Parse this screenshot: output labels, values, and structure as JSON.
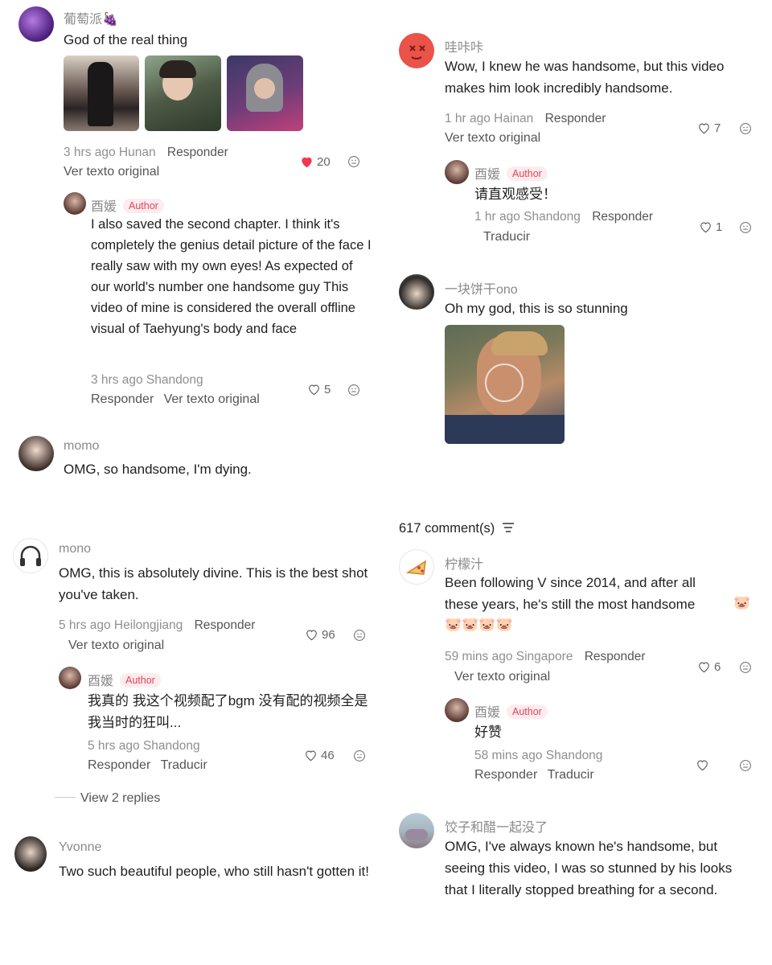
{
  "left": {
    "c1": {
      "user": "葡萄派🍇",
      "text": "God of the real thing",
      "time": "3 hrs ago Hunan",
      "reply": "Responder",
      "translate": "Ver texto original",
      "likes": "20",
      "reply1": {
        "user": "酉媛",
        "badge": "Author",
        "text": "I also saved the second chapter. I think it's completely the genius detail picture of the face I really saw with my own eyes! As expected of our world's number one handsome guy This video of mine is considered the overall offline visual of Taehyung's body and face",
        "time": "3 hrs ago Shandong",
        "reply": "Responder",
        "translate": "Ver texto original",
        "likes": "5"
      }
    },
    "c2": {
      "user": "momo",
      "text": "OMG, so handsome, I'm dying."
    },
    "c3": {
      "user": "mono",
      "text": "OMG, this is absolutely divine. This is the best shot you've taken.",
      "time": "5 hrs ago Heilongjiang",
      "reply": "Responder",
      "translate": "Ver texto original",
      "likes": "96",
      "reply1": {
        "user": "酉媛",
        "badge": "Author",
        "text": "我真的 我这个视频配了bgm 没有配的视频全是我当时的狂叫...",
        "time": "5 hrs ago Shandong",
        "reply": "Responder",
        "translate": "Traducir",
        "likes": "46"
      },
      "view_replies": "View 2 replies"
    },
    "c4": {
      "user": "Yvonne",
      "text": "Two such beautiful people, who still hasn't gotten it!"
    }
  },
  "right": {
    "c1": {
      "user": "哇咔咔",
      "text": "Wow, I knew he was handsome, but this video makes him look incredibly handsome.",
      "time": "1 hr ago Hainan",
      "reply": "Responder",
      "translate": "Ver texto original",
      "likes": "7",
      "reply1": {
        "user": "酉媛",
        "badge": "Author",
        "text": "请直观感受！",
        "time": "1 hr ago Shandong",
        "reply": "Responder",
        "translate": "Traducir",
        "likes": "1"
      }
    },
    "c2": {
      "user": "一块饼干ono",
      "text": "Oh my god, this is so stunning"
    },
    "count": "617 comment(s)",
    "c3": {
      "user": "柠檬汁",
      "text": "Been following V since 2014, and after all these years, he's still the most handsome",
      "time": "59 mins ago Singapore",
      "reply": "Responder",
      "translate": "Ver texto original",
      "likes": "6",
      "reply1": {
        "user": "酉媛",
        "badge": "Author",
        "text": "好赞",
        "time": "58 mins ago Shandong",
        "reply": "Responder",
        "translate": "Traducir"
      }
    },
    "c4": {
      "user": "饺子和醋一起没了",
      "text": "OMG, I've always known he's handsome, but seeing this video, I was so stunned by his looks that I literally stopped breathing for a second."
    }
  },
  "colors": {
    "heart_active": "#f0384f",
    "author_badge": "#e0455a"
  },
  "icons": [
    "heart-icon",
    "heart-filled-icon",
    "emoji-icon",
    "sort-icon",
    "grape-emoji",
    "pig-emoji",
    "headphones-icon",
    "pizza-icon"
  ]
}
